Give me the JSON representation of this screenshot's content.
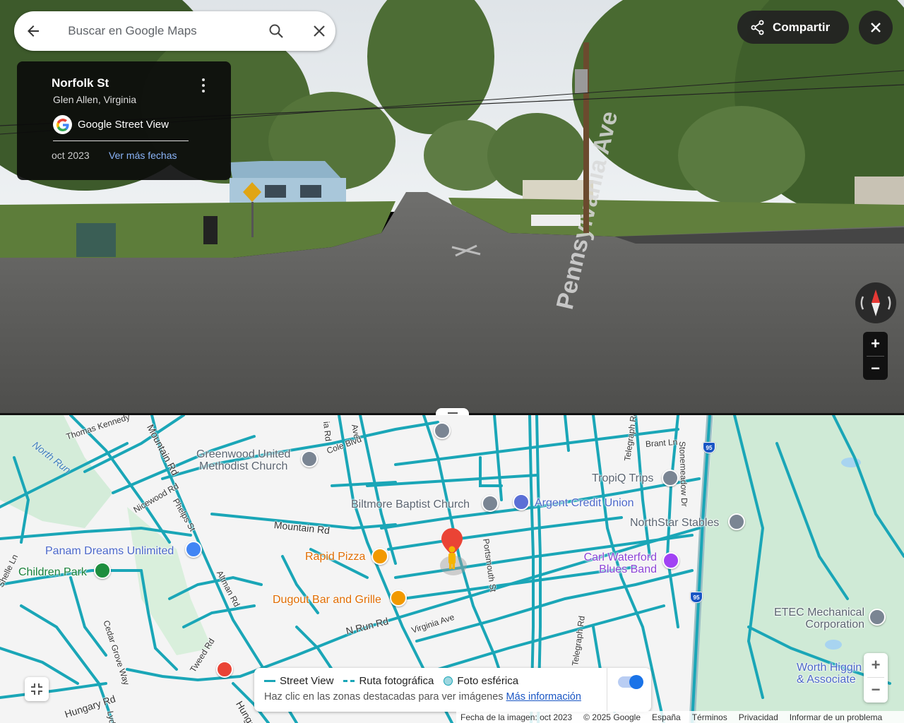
{
  "search": {
    "placeholder": "Buscar en Google Maps"
  },
  "header": {
    "share_label": "Compartir"
  },
  "info_card": {
    "street": "Norfolk St",
    "locality": "Glen Allen, Virginia",
    "source": "Google Street View",
    "capture_date": "oct 2023",
    "more_dates_link": "Ver más fechas"
  },
  "scene": {
    "road_sign": "Pennsylvania Ave"
  },
  "map": {
    "roads": [
      "Thomas Kennedy",
      "North Run",
      "Mountain Rd",
      "Cole Blvd",
      "Nicewood Rd",
      "Phelps St",
      "Mountain Rd",
      "Portsmouth St",
      "Telegraph Rd",
      "Brant Ln",
      "Stonemeadow Dr",
      "Altman Rd",
      "Cedar Grove Way",
      "Tweed Rd",
      "N Run Rd",
      "Virginia Ave",
      "Telegraph Rd",
      "Hungary Rd",
      "Hungary Rd",
      "Lydell",
      "Shelle Ln",
      "Ave",
      "ia Rd"
    ],
    "pois": [
      {
        "name": "Greenwood United\nMethodist Church",
        "icon": "church-icon",
        "color": "#7a8593"
      },
      {
        "name": "Biltmore Baptist Church",
        "icon": "church-icon",
        "color": "#7a8593"
      },
      {
        "name": "Argent Credit Union",
        "icon": "bank-icon",
        "color": "#5b6fd6"
      },
      {
        "name": "TropiQ Trips",
        "icon": "pin-icon",
        "color": "#7a8593"
      },
      {
        "name": "NorthStar Stables",
        "icon": "pin-icon",
        "color": "#7a8593"
      },
      {
        "name": "Panam Dreams Unlimited",
        "icon": "shopping-icon",
        "color": "#4285f4"
      },
      {
        "name": "Children Park",
        "icon": "tree-icon",
        "color": "#1e8e3e"
      },
      {
        "name": "Rapid Pizza",
        "icon": "restaurant-icon",
        "color": "#f29900"
      },
      {
        "name": "Dugout Bar and Grille",
        "icon": "restaurant-icon",
        "color": "#f29900"
      },
      {
        "name": "Carl Waterford\nBlues Band",
        "icon": "theater-icon",
        "color": "#a142f4"
      },
      {
        "name": "ETEC Mechanical\nCorporation",
        "icon": "pin-icon",
        "color": "#7a8593"
      },
      {
        "name": "Worth Higgin\n& Associate",
        "icon": "pin-icon",
        "color": "#4285f4"
      }
    ],
    "highway_shield": "95"
  },
  "legend": {
    "street_view": "Street View",
    "photo_path": "Ruta fotográfica",
    "spherical_photo": "Foto esférica",
    "hint": "Haz clic en las zonas destacadas para ver imágenes",
    "more_info_link": "Más información",
    "toggle_on": true
  },
  "footer": {
    "image_date": "Fecha de la imagen: oct 2023",
    "copyright": "© 2025 Google",
    "region": "España",
    "terms": "Términos",
    "privacy": "Privacidad",
    "report": "Informar de un problema"
  },
  "colors": {
    "coverage": "#1aa6b7",
    "accent": "#1a73e8",
    "pegman": "#f5b400",
    "pin_red": "#ea4335"
  }
}
